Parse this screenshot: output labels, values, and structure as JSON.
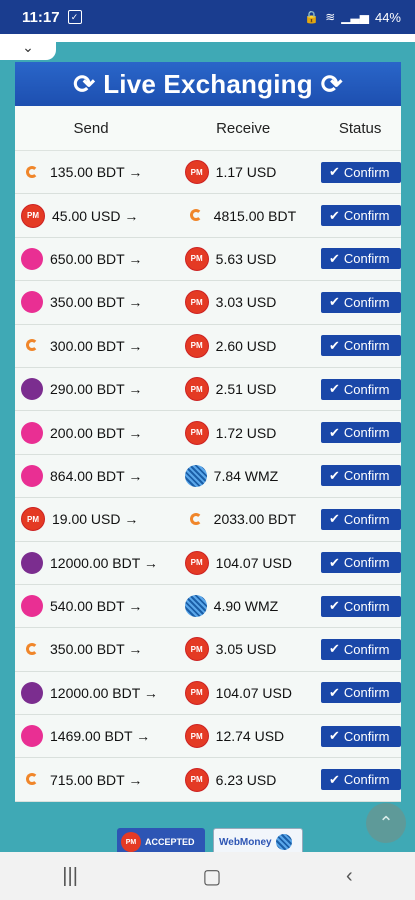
{
  "status_bar": {
    "time": "11:17",
    "battery": "44%"
  },
  "banner": {
    "title": "Live Exchanging"
  },
  "table": {
    "headers": {
      "send": "Send",
      "receive": "Receive",
      "status": "Status"
    },
    "rows": [
      {
        "send": "135.00 BDT →",
        "send_icon": "nagad-icon",
        "receive": "1.17 USD",
        "receive_icon": "perfect-money-icon",
        "status": "Confirm"
      },
      {
        "send": "45.00 USD →",
        "send_icon": "perfect-money-icon",
        "receive": "4815.00 BDT",
        "receive_icon": "nagad-icon",
        "status": "Confirm"
      },
      {
        "send": "650.00 BDT →",
        "send_icon": "bkash-icon",
        "receive": "5.63 USD",
        "receive_icon": "perfect-money-icon",
        "status": "Confirm"
      },
      {
        "send": "350.00 BDT →",
        "send_icon": "bkash-icon",
        "receive": "3.03 USD",
        "receive_icon": "perfect-money-icon",
        "status": "Confirm"
      },
      {
        "send": "300.00 BDT →",
        "send_icon": "nagad-icon",
        "receive": "2.60 USD",
        "receive_icon": "perfect-money-icon",
        "status": "Confirm"
      },
      {
        "send": "290.00 BDT →",
        "send_icon": "rocket-icon",
        "receive": "2.51 USD",
        "receive_icon": "perfect-money-icon",
        "status": "Confirm"
      },
      {
        "send": "200.00 BDT →",
        "send_icon": "bkash-icon",
        "receive": "1.72 USD",
        "receive_icon": "perfect-money-icon",
        "status": "Confirm"
      },
      {
        "send": "864.00 BDT →",
        "send_icon": "bkash-icon",
        "receive": "7.84 WMZ",
        "receive_icon": "webmoney-icon",
        "status": "Confirm"
      },
      {
        "send": "19.00 USD →",
        "send_icon": "perfect-money-icon",
        "receive": "2033.00 BDT",
        "receive_icon": "nagad-icon",
        "status": "Confirm"
      },
      {
        "send": "12000.00 BDT →",
        "send_icon": "rocket-icon",
        "receive": "104.07 USD",
        "receive_icon": "perfect-money-icon",
        "status": "Confirm"
      },
      {
        "send": "540.00 BDT →",
        "send_icon": "bkash-icon",
        "receive": "4.90 WMZ",
        "receive_icon": "webmoney-icon",
        "status": "Confirm"
      },
      {
        "send": "350.00 BDT →",
        "send_icon": "nagad-icon",
        "receive": "3.05 USD",
        "receive_icon": "perfect-money-icon",
        "status": "Confirm"
      },
      {
        "send": "12000.00 BDT →",
        "send_icon": "rocket-icon",
        "receive": "104.07 USD",
        "receive_icon": "perfect-money-icon",
        "status": "Confirm"
      },
      {
        "send": "1469.00 BDT →",
        "send_icon": "bkash-icon",
        "receive": "12.74 USD",
        "receive_icon": "perfect-money-icon",
        "status": "Confirm"
      },
      {
        "send": "715.00 BDT →",
        "send_icon": "nagad-icon",
        "receive": "6.23 USD",
        "receive_icon": "perfect-money-icon",
        "status": "Confirm"
      }
    ]
  },
  "footer": {
    "pm_badge": "ACCEPTED",
    "pm_badge_mark": "PM",
    "wm_badge": "WebMoney"
  },
  "colors": {
    "primary": "#1a47a8",
    "background": "#3fa9b5",
    "status_bar": "#1a3d8f"
  }
}
